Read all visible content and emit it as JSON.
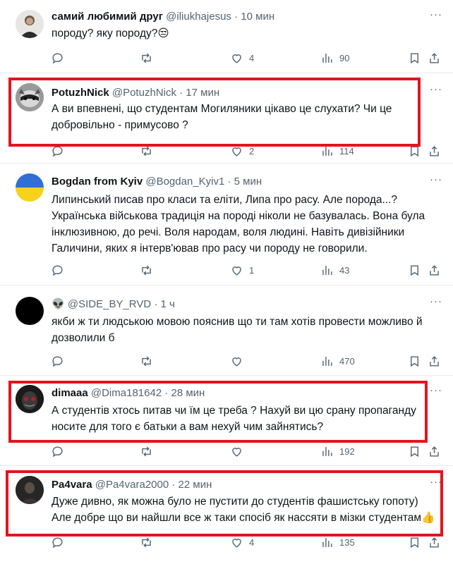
{
  "tweets": [
    {
      "name": "самий любимий друг",
      "handle": "@iliukhajesus",
      "time": "10 мин",
      "text": "породу? яку породу?😒",
      "replies": "",
      "reposts": "",
      "likes": "4",
      "views": "90",
      "avatar": "person-avatar"
    },
    {
      "name": "PotuzhNick",
      "handle": "@PotuzhNick",
      "time": "17 мин",
      "text": "А ви впевнені, що студентам Могиляники цікаво це слухати? Чи це добровільно - примусово ?",
      "replies": "",
      "reposts": "",
      "likes": "2",
      "views": "114",
      "avatar": "raccoon-avatar"
    },
    {
      "name": "Bogdan from Kyiv",
      "handle": "@Bogdan_Kyiv1",
      "time": "5 мин",
      "text": "Липинський писав про класи та еліти, Липа про расу. Але порода...? Українська військова традиція на породі ніколи не базувалась. Вона була інклюзивною, до речі. Воля народам, воля людині. Навіть дивізійники Галичини, яких я інтерв'ював про расу чи породу не говорили.",
      "replies": "",
      "reposts": "",
      "likes": "1",
      "views": "43",
      "avatar": "ukraine-flag-avatar"
    },
    {
      "name": "👽",
      "handle": "@SIDE_BY_RVD",
      "time": "1 ч",
      "text": "якби ж ти людською мовою пояснив що ти там хотів провести можливо й дозволили б",
      "replies": "",
      "reposts": "",
      "likes": "",
      "views": "470",
      "avatar": "black-avatar"
    },
    {
      "name": "dimaaa",
      "handle": "@Dima181642",
      "time": "28 мин",
      "text": "А студентів хтось питав чи їм це треба ? Нахуй ви цю срану пропаганду носите для того є батьки а вам нехуй чим зайнятись?",
      "replies": "",
      "reposts": "",
      "likes": "",
      "views": "192",
      "avatar": "masked-avatar"
    },
    {
      "name": "Pa4vara",
      "handle": "@Pa4vara2000",
      "time": "22 мин",
      "text": "Дуже дивно, як можна було не пустити до студентів фашистську гопоту)\nАле добре що ви найшли все ж таки спосіб як нассяти в мізки студентам👍",
      "replies": "",
      "reposts": "",
      "likes": "4",
      "views": "135",
      "avatar": "dark-photo-avatar"
    }
  ],
  "dot": "·",
  "more_glyph": "···",
  "colors": {
    "highlight": "#e3141e",
    "muted": "#536471",
    "text": "#0f1419"
  }
}
